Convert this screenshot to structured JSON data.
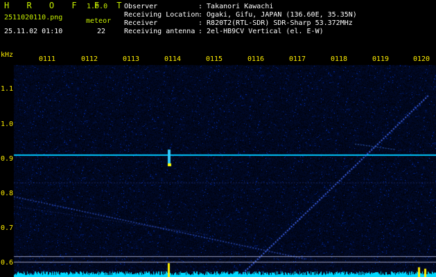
{
  "header": {
    "title": "H R O F F T",
    "version": "1.0.0",
    "filename": "2511020110.png",
    "datetime": "25.11.02 01:10",
    "meteor_label": "meteor",
    "meteor_count": "22",
    "rows": [
      {
        "label": "Observer",
        "value": ": Takanori Kawachi"
      },
      {
        "label": "Receiving Location",
        "value": ": Ogaki, Gifu, JAPAN (136.60E, 35.35N)"
      },
      {
        "label": "Receiver",
        "value": ": R820T2(RTL-SDR) SDR-Sharp 53.372MHz"
      },
      {
        "label": "Receiving antenna",
        "value": ": 2el-HB9CV Vertical (el. E-W)"
      }
    ]
  },
  "x_axis": {
    "ticks": [
      "0111",
      "0112",
      "0113",
      "0114",
      "0115",
      "0116",
      "0117",
      "0118",
      "0119",
      "0120"
    ]
  },
  "y_axis": {
    "unit": "kHz",
    "ticks": [
      "1.1",
      "1.0",
      "0.9",
      "0.8",
      "0.7",
      "0.6"
    ]
  },
  "colors": {
    "background": "#000000",
    "header_text": "#c8f000",
    "axis_text": "#ffee00",
    "carrier_line": "#00c8ff",
    "noise_floor": "#00d8ff"
  }
}
